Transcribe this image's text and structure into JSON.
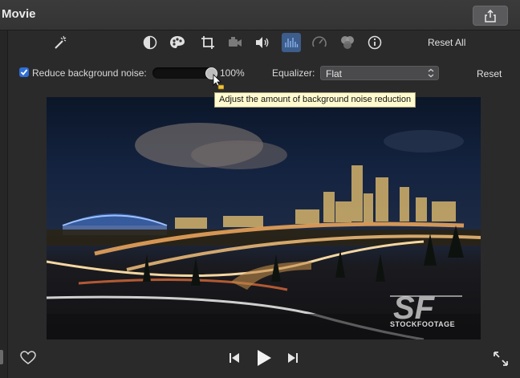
{
  "window": {
    "title": "Movie"
  },
  "toolbar": {
    "reset_all_label": "Reset All"
  },
  "noise": {
    "checkbox_checked": true,
    "label": "Reduce background noise:",
    "level": 1.0,
    "value_text": "100%",
    "tooltip": "Adjust the amount of background noise reduction"
  },
  "equalizer": {
    "label": "Equalizer:",
    "selected": "Flat"
  },
  "reset_label": "Reset",
  "viewer": {
    "watermark_text": "STOCKFOOTAGE"
  },
  "colors": {
    "accent": "#2f6fd6",
    "selected_tool": "#3d5d8c"
  }
}
